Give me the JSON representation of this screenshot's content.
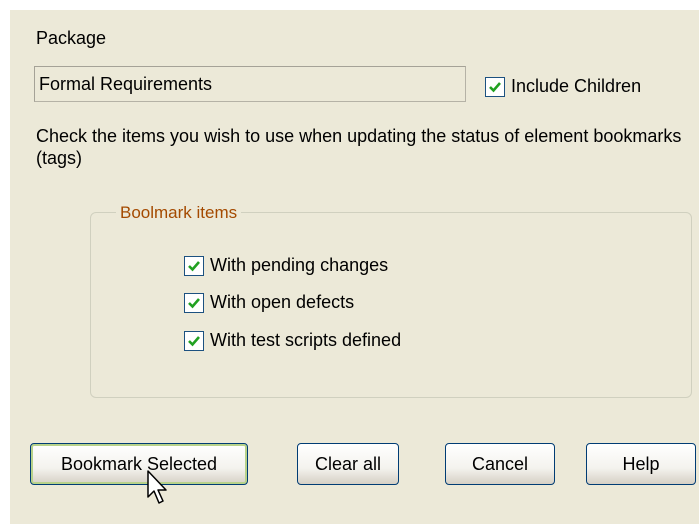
{
  "package": {
    "label": "Package",
    "value": "Formal Requirements",
    "include_children_label": "Include Children",
    "include_children_checked": true
  },
  "instructions": "Check the items you wish to use when updating the status of element bookmarks (tags)",
  "bookmark_group": {
    "title": "Boolmark items",
    "items": [
      {
        "label": "With pending changes",
        "checked": true
      },
      {
        "label": "With open defects",
        "checked": true
      },
      {
        "label": "With test scripts defined",
        "checked": true
      }
    ]
  },
  "buttons": {
    "bookmark_selected": "Bookmark Selected",
    "clear_all": "Clear all",
    "cancel": "Cancel",
    "help": "Help"
  },
  "colors": {
    "dialog_bg": "#ECE9D8",
    "group_title": "#A44A00",
    "checkmark": "#21A121",
    "button_border": "#003C74"
  }
}
